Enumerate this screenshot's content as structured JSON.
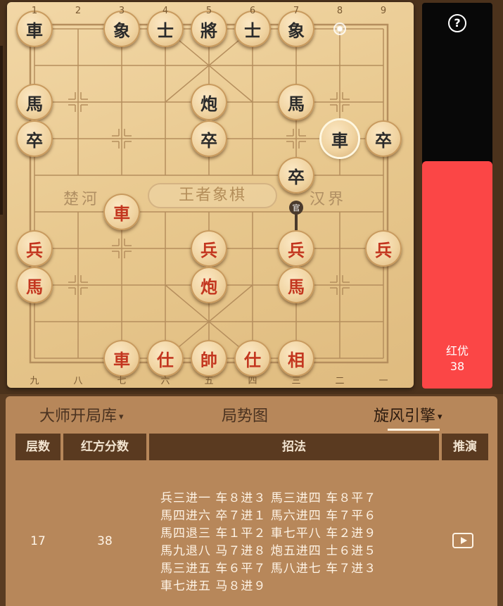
{
  "board": {
    "top_files": [
      "1",
      "2",
      "3",
      "4",
      "5",
      "6",
      "7",
      "8",
      "9"
    ],
    "bottom_files": [
      "九",
      "八",
      "七",
      "六",
      "五",
      "四",
      "三",
      "二",
      "一"
    ],
    "river_left": "楚河",
    "river_right": "汉界",
    "river_center": "王者象棋",
    "pieces": [
      {
        "ch": "車",
        "side": "black",
        "file": 0,
        "rank": 0
      },
      {
        "ch": "象",
        "side": "black",
        "file": 2,
        "rank": 0
      },
      {
        "ch": "士",
        "side": "black",
        "file": 3,
        "rank": 0
      },
      {
        "ch": "將",
        "side": "black",
        "file": 4,
        "rank": 0
      },
      {
        "ch": "士",
        "side": "black",
        "file": 5,
        "rank": 0
      },
      {
        "ch": "象",
        "side": "black",
        "file": 6,
        "rank": 0
      },
      {
        "ch": "馬",
        "side": "black",
        "file": 0,
        "rank": 2
      },
      {
        "ch": "炮",
        "side": "black",
        "file": 4,
        "rank": 2
      },
      {
        "ch": "馬",
        "side": "black",
        "file": 6,
        "rank": 2
      },
      {
        "ch": "卒",
        "side": "black",
        "file": 0,
        "rank": 3
      },
      {
        "ch": "卒",
        "side": "black",
        "file": 4,
        "rank": 3
      },
      {
        "ch": "車",
        "side": "black",
        "file": 7,
        "rank": 3,
        "selected": true
      },
      {
        "ch": "卒",
        "side": "black",
        "file": 8,
        "rank": 3
      },
      {
        "ch": "卒",
        "side": "black",
        "file": 6,
        "rank": 4
      },
      {
        "ch": "車",
        "side": "red",
        "file": 2,
        "rank": 5
      },
      {
        "ch": "兵",
        "side": "red",
        "file": 0,
        "rank": 6
      },
      {
        "ch": "兵",
        "side": "red",
        "file": 4,
        "rank": 6
      },
      {
        "ch": "兵",
        "side": "red",
        "file": 6,
        "rank": 6
      },
      {
        "ch": "兵",
        "side": "red",
        "file": 8,
        "rank": 6
      },
      {
        "ch": "馬",
        "side": "red",
        "file": 0,
        "rank": 7
      },
      {
        "ch": "炮",
        "side": "red",
        "file": 4,
        "rank": 7
      },
      {
        "ch": "馬",
        "side": "red",
        "file": 6,
        "rank": 7
      },
      {
        "ch": "車",
        "side": "red",
        "file": 2,
        "rank": 9
      },
      {
        "ch": "仕",
        "side": "red",
        "file": 3,
        "rank": 9
      },
      {
        "ch": "帥",
        "side": "red",
        "file": 4,
        "rank": 9
      },
      {
        "ch": "仕",
        "side": "red",
        "file": 5,
        "rank": 9
      },
      {
        "ch": "相",
        "side": "red",
        "file": 6,
        "rank": 9
      }
    ],
    "last_move_dot": {
      "file": 7,
      "rank": 0
    },
    "marker_label": "官"
  },
  "eval": {
    "label": "红优",
    "score": "38",
    "red_fraction": 0.59,
    "colors": {
      "red": "#fb4646",
      "black": "#080808"
    }
  },
  "help_icon": "?",
  "tabs": [
    {
      "label": "大师开局库",
      "caret": "▾"
    },
    {
      "label": "局势图"
    },
    {
      "label": "旋风引擎",
      "caret": "▾",
      "active": true
    }
  ],
  "table": {
    "headers": [
      "层数",
      "红方分数",
      "招法",
      "推演"
    ],
    "row": {
      "depth": "17",
      "score": "38",
      "moves": [
        "兵三进一 车８进３ 馬三进四 车８平７",
        "馬四进六 卒７进１ 馬六进四 车７平６",
        "馬四退三 车１平２ 車七平八 车２进９",
        "馬九退八 马７进８ 炮五进四 士６进５",
        "馬三进五 车６平７ 馬八进七 车７进３",
        "車七进五 马８进９"
      ]
    }
  }
}
